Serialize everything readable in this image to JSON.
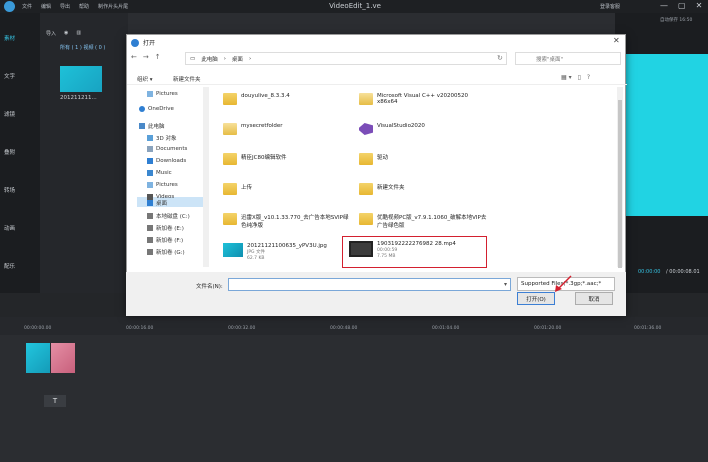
{
  "app": {
    "title": "VideoEdit_1.ve",
    "menu": [
      "文件",
      "编辑",
      "导出",
      "帮助",
      "制作片头片尾"
    ],
    "account": "登录客服",
    "win_controls": [
      "—",
      "▢",
      "✕"
    ],
    "side_tabs": [
      "素材",
      "文字",
      "滤镜",
      "叠附",
      "转场",
      "动画",
      "配乐"
    ],
    "media_toolbar": [
      "导入",
      "◉",
      "▥"
    ],
    "media_filter": "所有 ( 1 )  视频 ( 0 )",
    "media_item_name": "201211211...",
    "autosave": "自动保存 16:50",
    "preview_time_a": "00:00:00",
    "preview_time_b": "/ 00:00:08.01",
    "ruler": [
      "00:00:00.00",
      "00:00:16.00",
      "00:00:32.00",
      "00:00:48.00",
      "00:01:04.00",
      "00:01:20.00",
      "00:01:36.00"
    ],
    "track_text": "T",
    "colors": {
      "accent": "#1ec1d8",
      "highlight": "#d3202f"
    }
  },
  "dialog": {
    "title": "打开",
    "close": "✕",
    "nav": [
      "←",
      "→",
      "↑"
    ],
    "breadcrumb": [
      "此电脑",
      "桌面"
    ],
    "refresh": "↻",
    "search_placeholder": "搜索\"桌面\"",
    "organize": "组织 ▾",
    "new_folder": "新建文件夹",
    "view_icons": [
      "▦ ▾",
      "▯",
      "?"
    ],
    "tree": [
      "Pictures",
      "OneDrive",
      "此电脑",
      "3D 对象",
      "Documents",
      "Downloads",
      "Music",
      "Pictures",
      "Videos",
      "桌面",
      "本地磁盘 (C:)",
      "新加卷 (E:)",
      "新加卷 (F:)",
      "新加卷 (G:)"
    ],
    "files": [
      {
        "name": "douyulive_8.3.3.4",
        "meta": ""
      },
      {
        "name": "Microsoft Visual C++ v20200520 x86x64",
        "meta": ""
      },
      {
        "name": "mysecretfolder",
        "meta": ""
      },
      {
        "name": "VisualStudio2020",
        "meta": ""
      },
      {
        "name": "精臣JC80编辑软件",
        "meta": ""
      },
      {
        "name": "驱动",
        "meta": ""
      },
      {
        "name": "上传",
        "meta": ""
      },
      {
        "name": "新建文件夹",
        "meta": ""
      },
      {
        "name": "迅雷X版_v10.1.33.770_去广告本地SVIP绿色纯净版",
        "meta": ""
      },
      {
        "name": "优酷视频PC版_v7.9.1.1060_破解本地VIP去广告绿色版",
        "meta": ""
      },
      {
        "name": "20121121100635_yPV3U.jpg",
        "meta_type": "JPG 文件",
        "meta_size": "62.7 KB"
      },
      {
        "name": "1903192222276982 28.mp4",
        "meta_type": "00:00:59",
        "meta_size": "7.75 MB"
      }
    ],
    "filename_label": "文件名(N):",
    "filetype": "Supported Files(*.3gp;*.aac;*",
    "open_label": "打开(O)",
    "cancel_label": "取消"
  }
}
